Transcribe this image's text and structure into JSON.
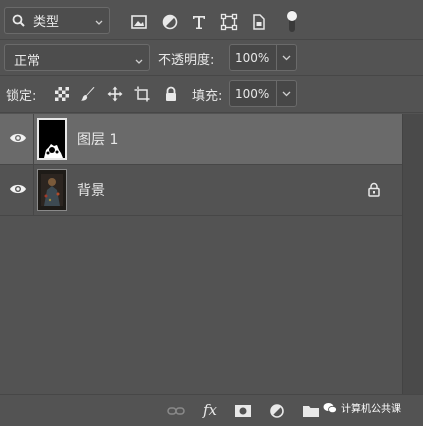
{
  "filter": {
    "kind_label": "类型"
  },
  "blend": {
    "mode": "正常",
    "opacity_label": "不透明度:",
    "opacity_value": "100%"
  },
  "lock": {
    "label": "锁定:",
    "fill_label": "填充:",
    "fill_value": "100%"
  },
  "layers": [
    {
      "name": "图层 1",
      "selected": true,
      "visible": true,
      "locked": false
    },
    {
      "name": "背景",
      "selected": false,
      "visible": true,
      "locked": true
    }
  ],
  "footer": {
    "fx_label": "fx"
  },
  "watermark": {
    "text": "计算机公共课"
  },
  "colors": {
    "panel_bg": "#535353",
    "selected_row": "#6a6a6a",
    "text": "#e8e8e8"
  }
}
